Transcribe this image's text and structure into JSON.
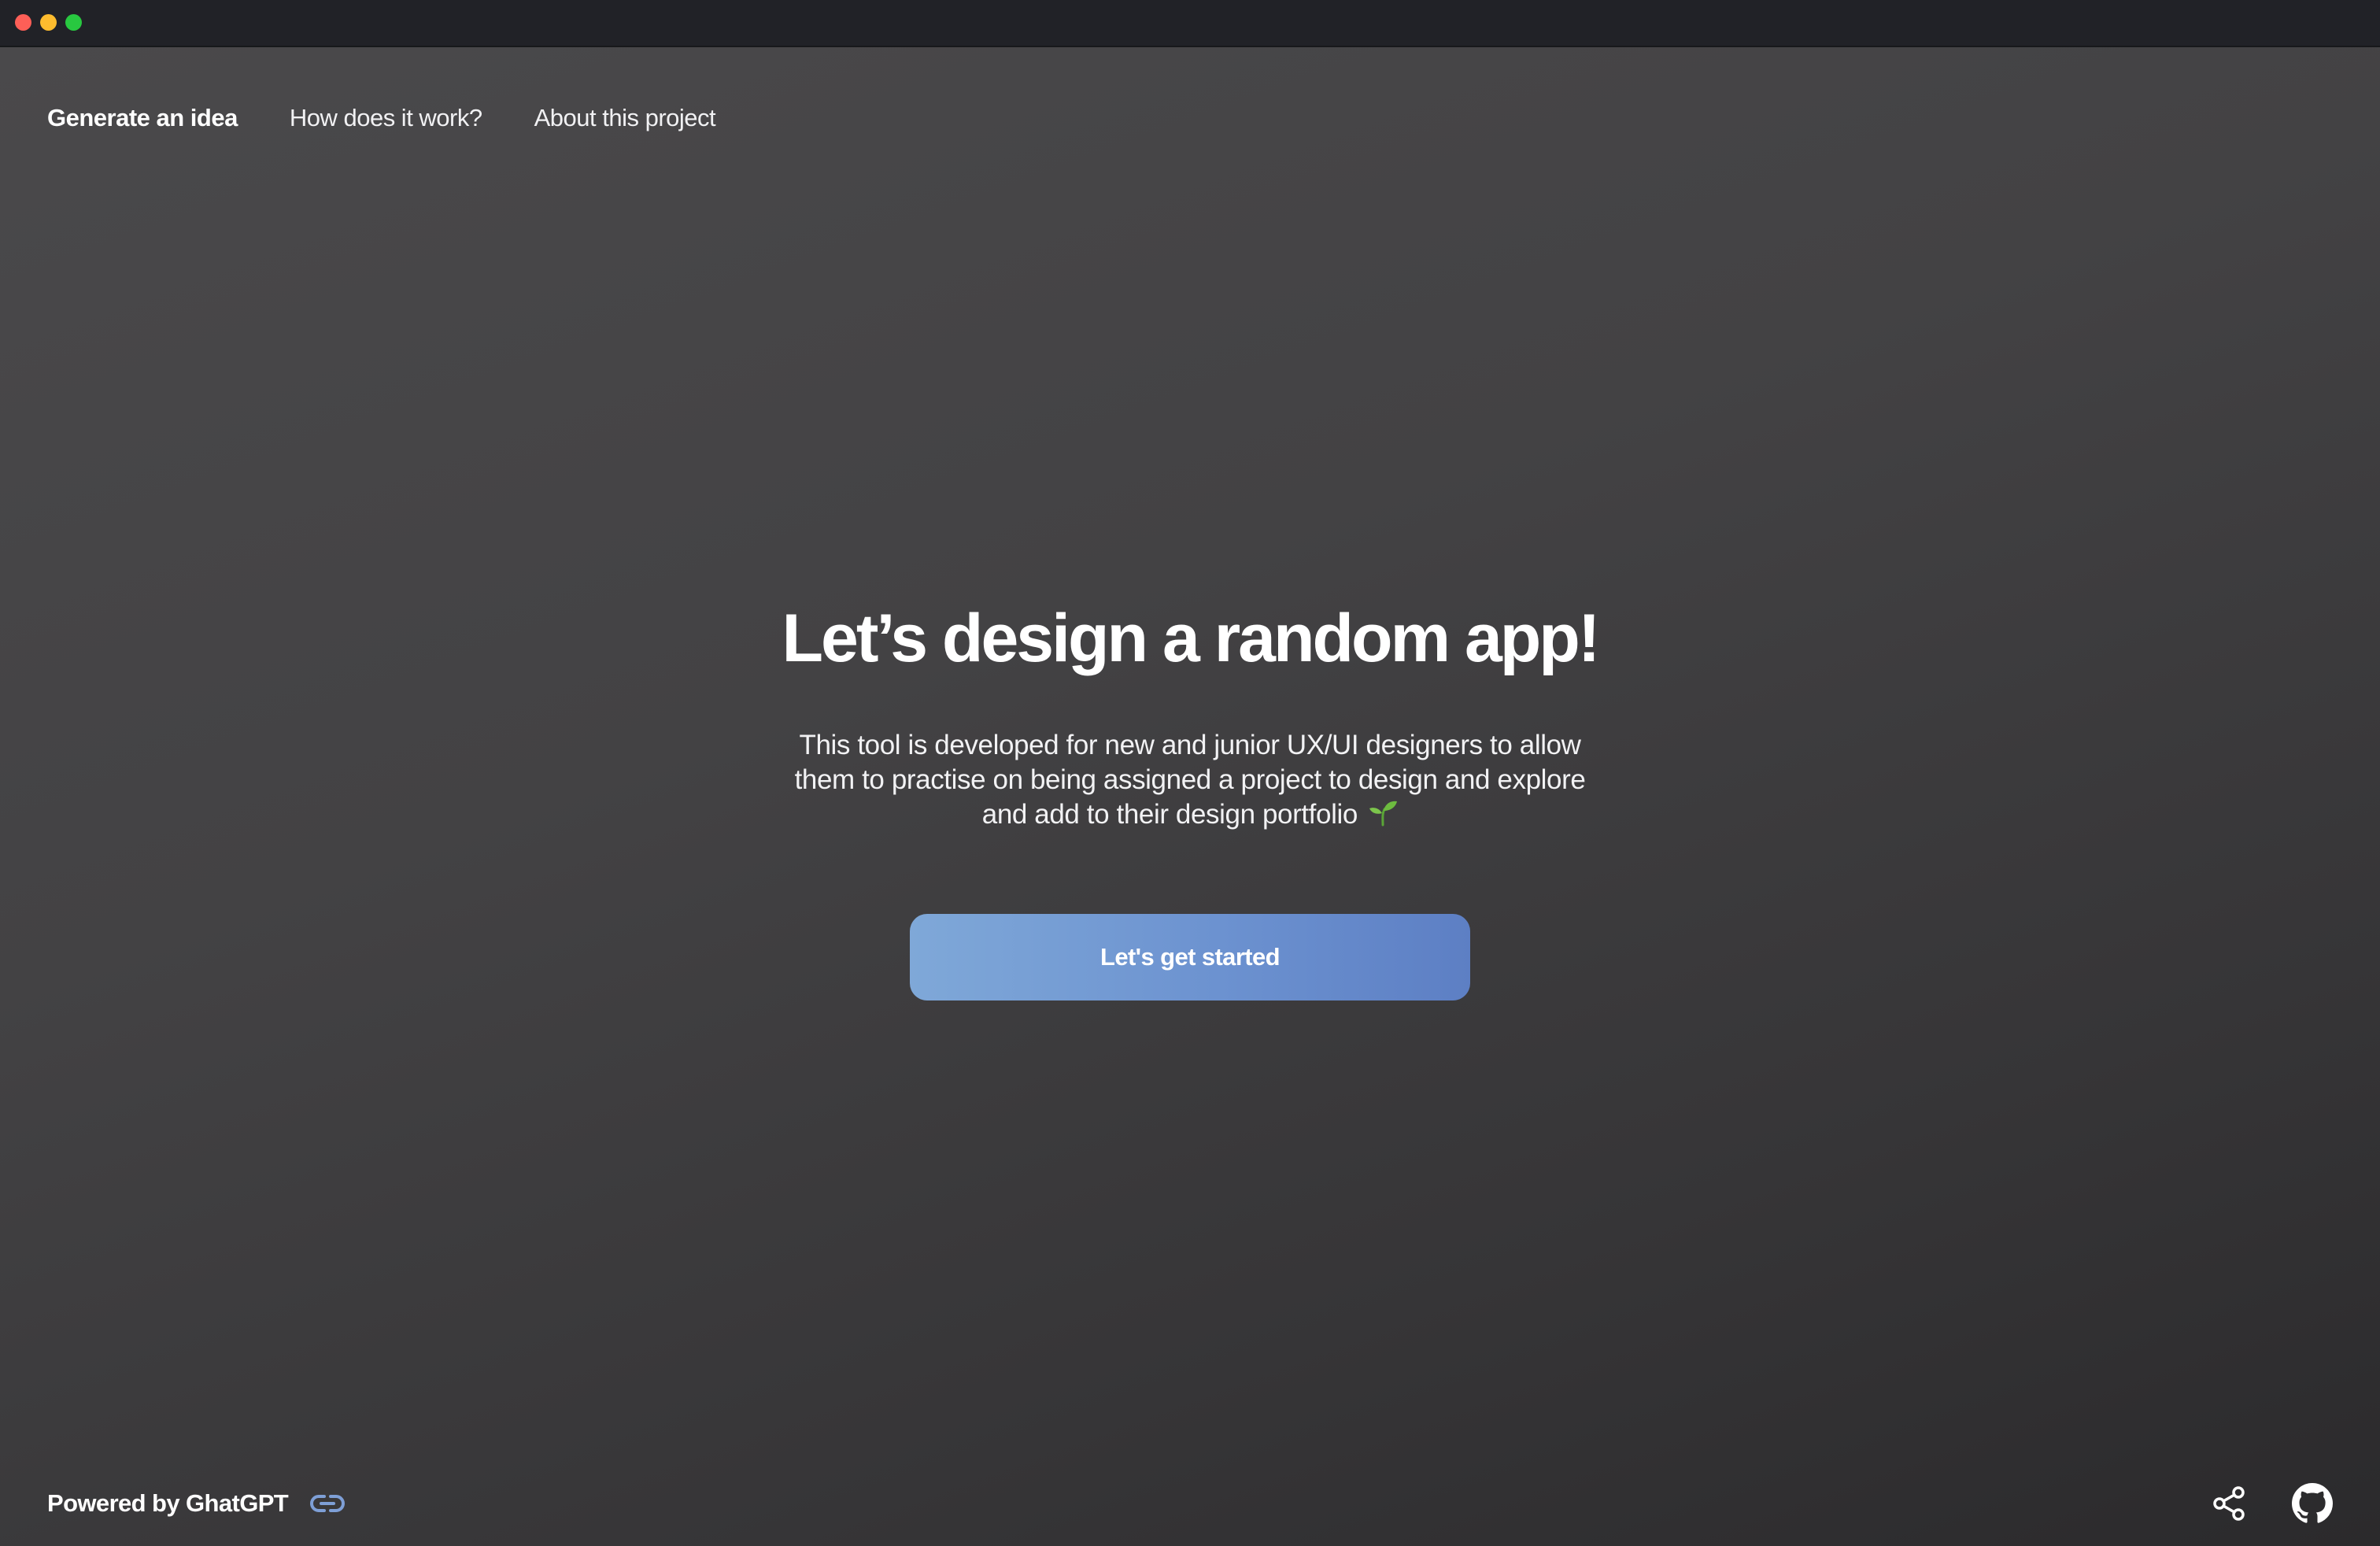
{
  "window": {
    "controls": [
      "close",
      "minimize",
      "maximize"
    ]
  },
  "nav": {
    "items": [
      {
        "label": "Generate an idea",
        "active": true
      },
      {
        "label": "How does it work?",
        "active": false
      },
      {
        "label": "About this project",
        "active": false
      }
    ]
  },
  "hero": {
    "title": "Let’s design a random app!",
    "description": "This tool is developed for new and junior UX/UI designers to allow them to practise on being assigned a project to design and explore and add to their design portfolio",
    "description_icon": "seedling-icon",
    "cta_label": "Let's get started"
  },
  "footer": {
    "powered_by": "Powered by GhatGPT",
    "link_icon": "link-icon",
    "share_icon": "share-icon",
    "github_icon": "github-icon"
  },
  "colors": {
    "accent_start": "#7fa8d8",
    "accent_end": "#5d7fc4",
    "link_icon": "#7e9fd6"
  }
}
